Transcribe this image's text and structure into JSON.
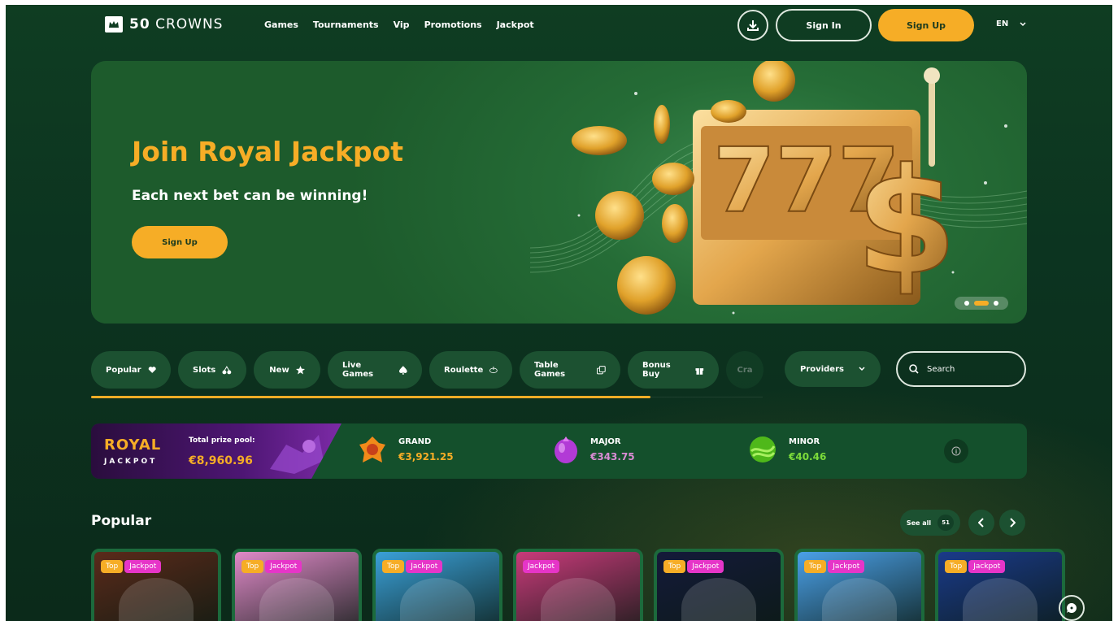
{
  "header": {
    "logo_number": "50",
    "logo_word": "CROWNS",
    "nav": [
      "Games",
      "Tournaments",
      "Vip",
      "Promotions",
      "Jackpot"
    ],
    "signin_label": "Sign In",
    "signup_label": "Sign Up",
    "lang": "EN"
  },
  "hero": {
    "title": "Join Royal Jackpot",
    "subtitle": "Each next bet can be winning!",
    "button_label": "Sign Up"
  },
  "categories": [
    {
      "label": "Popular",
      "icon": "heart-icon"
    },
    {
      "label": "Slots",
      "icon": "cherries-icon"
    },
    {
      "label": "New",
      "icon": "star-icon"
    },
    {
      "label": "Live Games",
      "icon": "spade-icon"
    },
    {
      "label": "Roulette",
      "icon": "roulette-icon"
    },
    {
      "label": "Table Games",
      "icon": "dice-icon"
    },
    {
      "label": "Bonus Buy",
      "icon": "gift-icon"
    },
    {
      "label": "Cra",
      "icon": ""
    }
  ],
  "providers_label": "Providers",
  "search": {
    "placeholder": "Search"
  },
  "jackpot": {
    "royal": "ROYAL",
    "jackpot_word": "JACKPOT",
    "total_label": "Total prize pool:",
    "total_value": "€8,960.96",
    "tiers": [
      {
        "name": "GRAND",
        "value": "€3,921.25",
        "color": "#f6ad26"
      },
      {
        "name": "MAJOR",
        "value": "€343.75",
        "color": "#d98cd4"
      },
      {
        "name": "MINOR",
        "value": "€40.46",
        "color": "#7ddc3a"
      }
    ]
  },
  "popular": {
    "title": "Popular",
    "see_all": "See all",
    "count": "51"
  },
  "cards": [
    {
      "badges": [
        "Top",
        "Jackpot"
      ],
      "bg": "#5a2a1a"
    },
    {
      "badges": [
        "Top",
        "Jackpot"
      ],
      "bg": "#e089c8"
    },
    {
      "badges": [
        "Top",
        "Jackpot"
      ],
      "bg": "#3aa0d8"
    },
    {
      "badges": [
        "Jackpot"
      ],
      "bg": "#c83a7a"
    },
    {
      "badges": [
        "Top",
        "Jackpot"
      ],
      "bg": "#141a3a"
    },
    {
      "badges": [
        "Top",
        "Jackpot"
      ],
      "bg": "#4aa0e8"
    },
    {
      "badges": [
        "Top",
        "Jackpot"
      ],
      "bg": "#1a3a8a"
    }
  ]
}
